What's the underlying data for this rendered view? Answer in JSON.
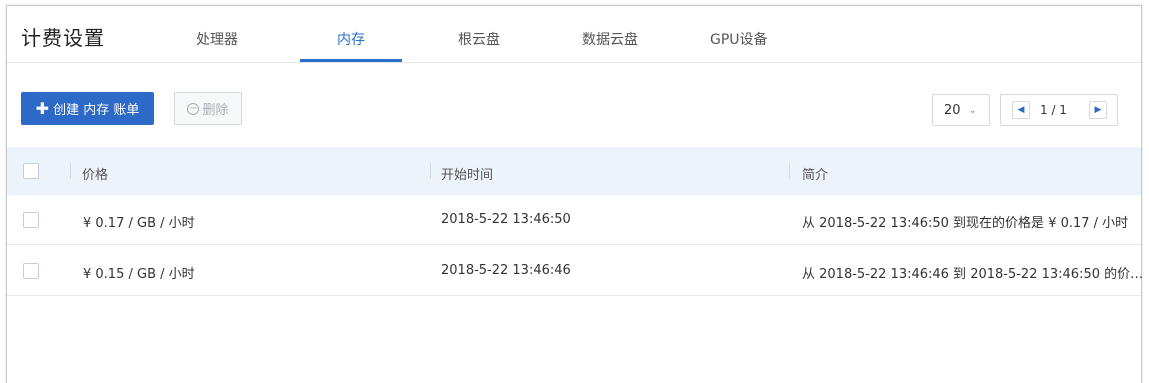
{
  "header": {
    "title": "计费设置",
    "tabs": [
      {
        "label": "处理器"
      },
      {
        "label": "内存"
      },
      {
        "label": "根云盘"
      },
      {
        "label": "数据云盘"
      },
      {
        "label": "GPU设备"
      }
    ],
    "active_tab": "内存"
  },
  "toolbar": {
    "create_label": "创建 内存 账单",
    "delete_label": "删除",
    "page_size": "20",
    "pagination": "1 / 1"
  },
  "table": {
    "columns": [
      "价格",
      "开始时间",
      "简介"
    ],
    "rows": [
      {
        "price": "¥ 0.17 / GB / 小时",
        "start": "2018-5-22 13:46:50",
        "desc": "从 2018-5-22 13:46:50 到现在的价格是 ¥ 0.17 / 小时"
      },
      {
        "price": "¥ 0.15 / GB / 小时",
        "start": "2018-5-22 13:46:46",
        "desc": "从 2018-5-22 13:46:46 到 2018-5-22 13:46:50 的价…"
      }
    ]
  },
  "colors": {
    "accent": "#2d6ac7",
    "header_bg": "#edf3fb"
  }
}
